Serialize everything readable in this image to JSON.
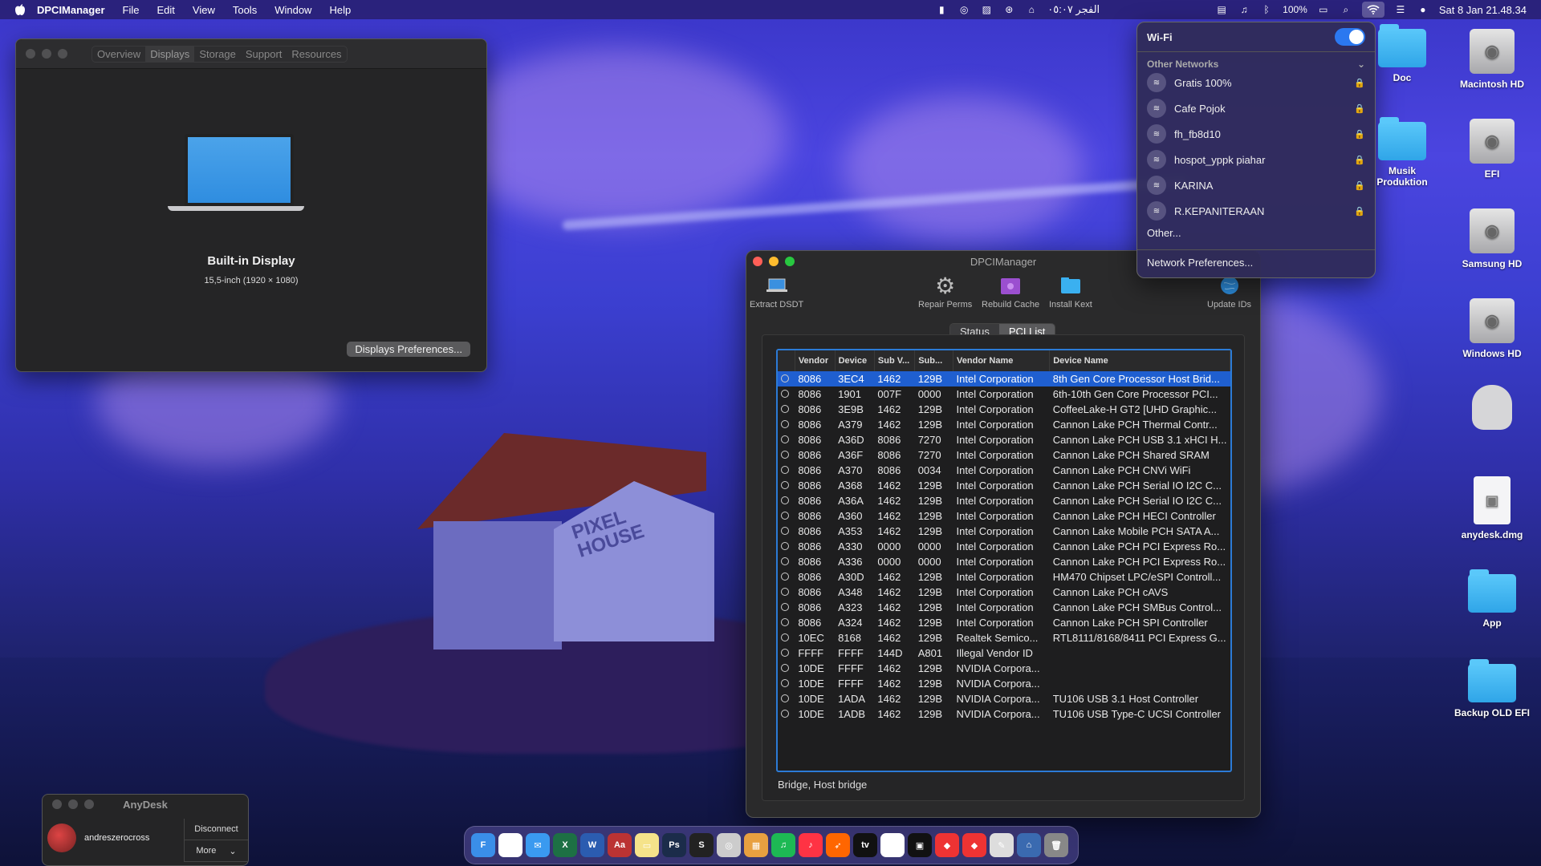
{
  "menubar": {
    "app_name": "DPCIManager",
    "items": [
      "File",
      "Edit",
      "View",
      "Tools",
      "Window",
      "Help"
    ],
    "prayer": "الفجر ٠٥:٠٧",
    "battery": "100%",
    "datetime": "Sat 8 Jan  21.48.34"
  },
  "displays_window": {
    "tabs": [
      "Overview",
      "Displays",
      "Storage",
      "Support",
      "Resources"
    ],
    "active_tab": "Displays",
    "display_name": "Built-in Display",
    "display_desc": "15,5-inch (1920 × 1080)",
    "prefs_button": "Displays Preferences..."
  },
  "dpci": {
    "title": "DPCIManager",
    "tools": {
      "extract": "Extract DSDT",
      "repair": "Repair Perms",
      "rebuild": "Rebuild Cache",
      "install": "Install Kext",
      "update": "Update IDs"
    },
    "segments": [
      "Status",
      "PCI List"
    ],
    "active_segment": "PCI List",
    "columns": [
      "Vendor",
      "Device",
      "Sub V...",
      "Sub...",
      "Vendor Name",
      "Device Name"
    ],
    "rows": [
      [
        "8086",
        "3EC4",
        "1462",
        "129B",
        "Intel Corporation",
        "8th Gen Core Processor Host Brid..."
      ],
      [
        "8086",
        "1901",
        "007F",
        "0000",
        "Intel Corporation",
        "6th-10th Gen Core Processor PCI..."
      ],
      [
        "8086",
        "3E9B",
        "1462",
        "129B",
        "Intel Corporation",
        "CoffeeLake-H GT2 [UHD Graphic..."
      ],
      [
        "8086",
        "A379",
        "1462",
        "129B",
        "Intel Corporation",
        "Cannon Lake PCH Thermal Contr..."
      ],
      [
        "8086",
        "A36D",
        "8086",
        "7270",
        "Intel Corporation",
        "Cannon Lake PCH USB 3.1 xHCI H..."
      ],
      [
        "8086",
        "A36F",
        "8086",
        "7270",
        "Intel Corporation",
        "Cannon Lake PCH Shared SRAM"
      ],
      [
        "8086",
        "A370",
        "8086",
        "0034",
        "Intel Corporation",
        "Cannon Lake PCH CNVi WiFi"
      ],
      [
        "8086",
        "A368",
        "1462",
        "129B",
        "Intel Corporation",
        "Cannon Lake PCH Serial IO I2C C..."
      ],
      [
        "8086",
        "A36A",
        "1462",
        "129B",
        "Intel Corporation",
        "Cannon Lake PCH Serial IO I2C C..."
      ],
      [
        "8086",
        "A360",
        "1462",
        "129B",
        "Intel Corporation",
        "Cannon Lake PCH HECI Controller"
      ],
      [
        "8086",
        "A353",
        "1462",
        "129B",
        "Intel Corporation",
        "Cannon Lake Mobile PCH SATA A..."
      ],
      [
        "8086",
        "A330",
        "0000",
        "0000",
        "Intel Corporation",
        "Cannon Lake PCH PCI Express Ro..."
      ],
      [
        "8086",
        "A336",
        "0000",
        "0000",
        "Intel Corporation",
        "Cannon Lake PCH PCI Express Ro..."
      ],
      [
        "8086",
        "A30D",
        "1462",
        "129B",
        "Intel Corporation",
        "HM470 Chipset LPC/eSPI Controll..."
      ],
      [
        "8086",
        "A348",
        "1462",
        "129B",
        "Intel Corporation",
        "Cannon Lake PCH cAVS"
      ],
      [
        "8086",
        "A323",
        "1462",
        "129B",
        "Intel Corporation",
        "Cannon Lake PCH SMBus Control..."
      ],
      [
        "8086",
        "A324",
        "1462",
        "129B",
        "Intel Corporation",
        "Cannon Lake PCH SPI Controller"
      ],
      [
        "10EC",
        "8168",
        "1462",
        "129B",
        "Realtek Semico...",
        "RTL8111/8168/8411 PCI Express G..."
      ],
      [
        "FFFF",
        "FFFF",
        "144D",
        "A801",
        "Illegal Vendor ID",
        ""
      ],
      [
        "10DE",
        "FFFF",
        "1462",
        "129B",
        "NVIDIA Corpora...",
        ""
      ],
      [
        "10DE",
        "FFFF",
        "1462",
        "129B",
        "NVIDIA Corpora...",
        ""
      ],
      [
        "10DE",
        "1ADA",
        "1462",
        "129B",
        "NVIDIA Corpora...",
        "TU106 USB 3.1 Host Controller"
      ],
      [
        "10DE",
        "1ADB",
        "1462",
        "129B",
        "NVIDIA Corpora...",
        "TU106 USB Type-C UCSI Controller"
      ]
    ],
    "selected_row": 0,
    "status_text": "Bridge, Host bridge"
  },
  "wifi": {
    "title": "Wi-Fi",
    "section": "Other Networks",
    "networks": [
      "Gratis 100%",
      "Cafe Pojok",
      "fh_fb8d10",
      "hospot_yppk piahar",
      "KARINA",
      "R.KEPANITERAAN"
    ],
    "other": "Other...",
    "prefs": "Network Preferences..."
  },
  "desktop": {
    "doc": "Doc",
    "macintosh": "Macintosh HD",
    "musik": "Musik Produktion",
    "efi": "EFI",
    "samsung": "Samsung HD",
    "windows": "Windows HD",
    "anydesk_dmg": "anydesk.dmg",
    "app": "App",
    "backup": "Backup OLD EFI"
  },
  "anydesk": {
    "title": "AnyDesk",
    "user": "andreszerocross",
    "disconnect": "Disconnect",
    "more": "More"
  },
  "dock": [
    "finder-icon",
    "chrome-icon",
    "mail-icon",
    "excel-icon",
    "word-icon",
    "dictionary-icon",
    "notes-icon",
    "photoshop-icon",
    "steam-icon",
    "utility-icon",
    "photos-icon",
    "spotify-icon",
    "music-icon",
    "swift-icon",
    "tv-icon",
    "app-icon",
    "app-icon",
    "anydesk-icon",
    "anydesk-icon",
    "script-icon",
    "network-icon",
    "trash-icon"
  ],
  "dock_labels": [
    "F",
    "C",
    "✉",
    "X",
    "W",
    "Aa",
    "▭",
    "Ps",
    "S",
    "◎",
    "▦",
    "♫",
    "♪",
    "➶",
    "tv",
    "▤",
    "▣",
    "◆",
    "◆",
    "✎",
    "⌂",
    "🗑"
  ],
  "colors": {
    "accent": "#1f5fd0",
    "selection_border": "#2c7bd6",
    "wifi_toggle": "#2b78f0"
  }
}
